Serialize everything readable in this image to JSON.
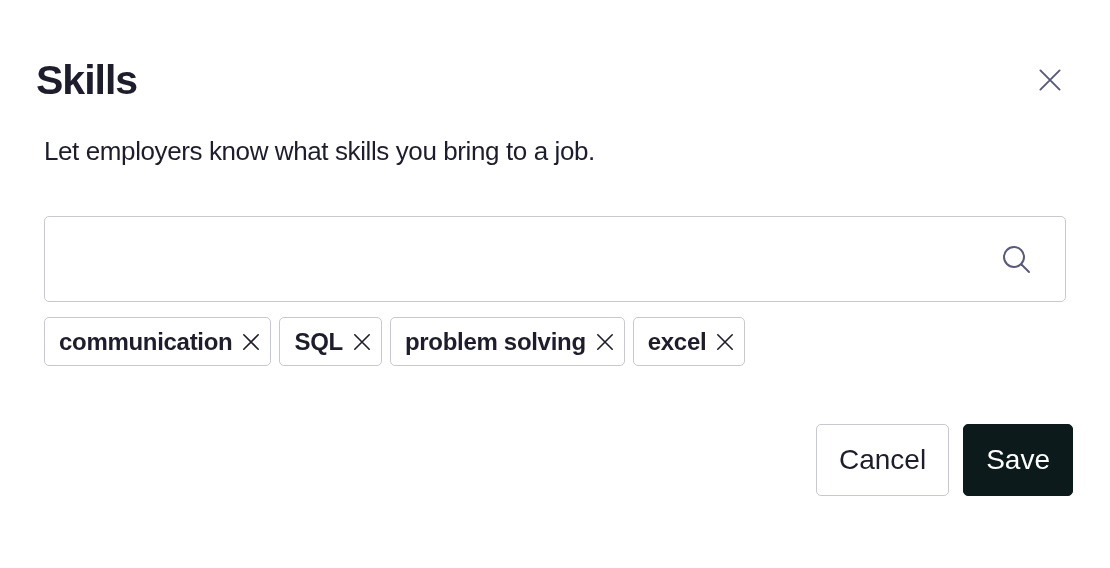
{
  "dialog": {
    "title": "Skills",
    "description": "Let employers know what skills you bring to a job."
  },
  "skills": [
    {
      "label": "communication"
    },
    {
      "label": "SQL"
    },
    {
      "label": "problem solving"
    },
    {
      "label": "excel"
    }
  ],
  "buttons": [
    {
      "label": "Cancel",
      "kind": "secondary"
    },
    {
      "label": "Save",
      "kind": "primary"
    }
  ]
}
